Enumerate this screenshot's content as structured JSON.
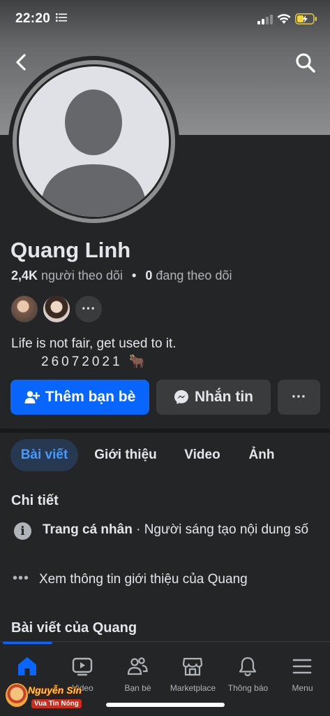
{
  "status_bar": {
    "time": "22:20"
  },
  "profile": {
    "name": "Quang Linh",
    "followers_count": "2,4K",
    "followers_label": "người theo dõi",
    "following_count": "0",
    "following_label": "đang theo dõi",
    "more_friends_label": "···",
    "bio_line1": "Life is not fair, get used to it.",
    "bio_line2": "26072021 🐂"
  },
  "actions": {
    "add_friend": "Thêm bạn bè",
    "message": "Nhắn tin",
    "more": "···"
  },
  "tabs": [
    {
      "label": "Bài viết",
      "active": true
    },
    {
      "label": "Giới thiệu"
    },
    {
      "label": "Video"
    },
    {
      "label": "Ảnh"
    }
  ],
  "details": {
    "title": "Chi tiết",
    "page_type_bold": "Trang cá nhân",
    "page_type_rest": " · Người sáng tạo nội dung số",
    "see_about": "Xem thông tin giới thiệu của Quang"
  },
  "posts": {
    "title": "Bài viết của Quang"
  },
  "bottom_nav": [
    {
      "label": "",
      "icon": "home-icon",
      "active": true
    },
    {
      "label": "Video",
      "icon": "video-icon"
    },
    {
      "label": "Bạn bè",
      "icon": "friends-icon"
    },
    {
      "label": "Marketplace",
      "icon": "marketplace-icon"
    },
    {
      "label": "Thông báo",
      "icon": "bell-icon"
    },
    {
      "label": "Menu",
      "icon": "menu-icon"
    }
  ],
  "watermark": {
    "name": "Nguyễn Sin",
    "tagline": "Vua Tin Nóng"
  },
  "colors": {
    "background": "#242526",
    "accent": "#0866ff",
    "secondary_button": "#3a3b3c",
    "active_tab_bg": "#263951",
    "active_tab_text": "#4599ff"
  }
}
